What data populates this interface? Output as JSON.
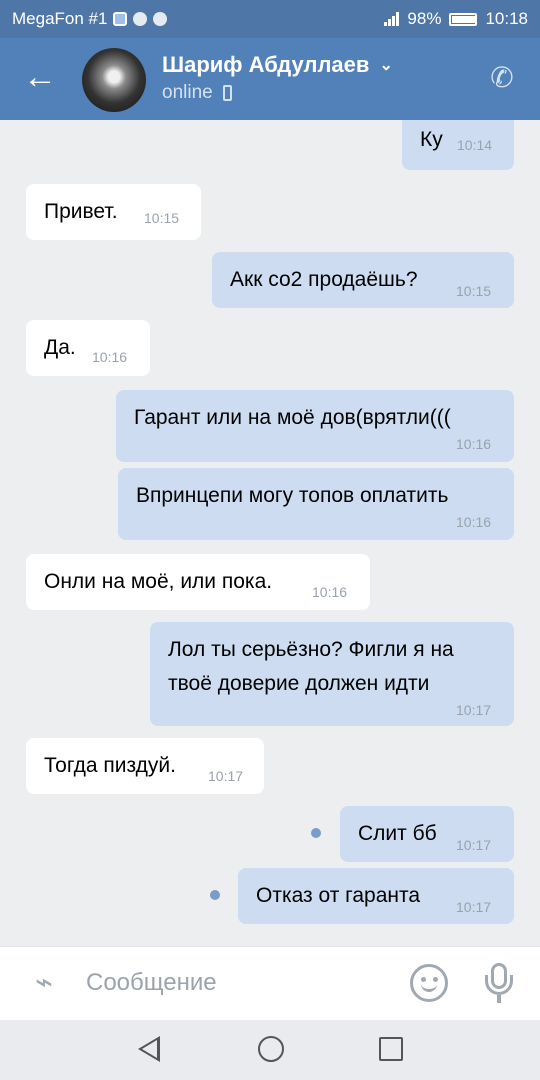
{
  "status_bar": {
    "carrier": "MegaFon #1",
    "battery": "98%",
    "time": "10:18"
  },
  "header": {
    "contact_name": "Шариф Абдуллаев",
    "status": "online"
  },
  "messages": [
    {
      "direction": "out",
      "text": "Ку",
      "time": "10:14"
    },
    {
      "direction": "in",
      "text": "Привет.",
      "time": "10:15"
    },
    {
      "direction": "out",
      "text": "Акк со2 продаёшь?",
      "time": "10:15"
    },
    {
      "direction": "in",
      "text": "Да.",
      "time": "10:16"
    },
    {
      "direction": "out",
      "text": "Гарант или на моё дов(врятли(((",
      "time": "10:16"
    },
    {
      "direction": "out",
      "text": "Впринцепи могу топов оплатить",
      "time": "10:16"
    },
    {
      "direction": "in",
      "text": "Онли на моё, или пока.",
      "time": "10:16"
    },
    {
      "direction": "out",
      "text_line1": "Лол ты серьёзно? Фигли я на",
      "text_line2": "твоё доверие должен идти",
      "time": "10:17"
    },
    {
      "direction": "in",
      "text": "Тогда пиздуй.",
      "time": "10:17"
    },
    {
      "direction": "out",
      "text": "Слит бб",
      "time": "10:17",
      "unread": true
    },
    {
      "direction": "out",
      "text": "Отказ от гаранта",
      "time": "10:17",
      "unread": true
    }
  ],
  "composer": {
    "placeholder": "Сообщение"
  },
  "icons": {
    "back": "arrow-left-icon",
    "call": "phone-icon",
    "attach": "paperclip-icon",
    "emoji": "smiley-icon",
    "mic": "microphone-icon"
  },
  "colors": {
    "header": "#5181b8",
    "outgoing_bubble": "#cddcf1",
    "incoming_bubble": "#ffffff",
    "background": "#edeef0"
  }
}
